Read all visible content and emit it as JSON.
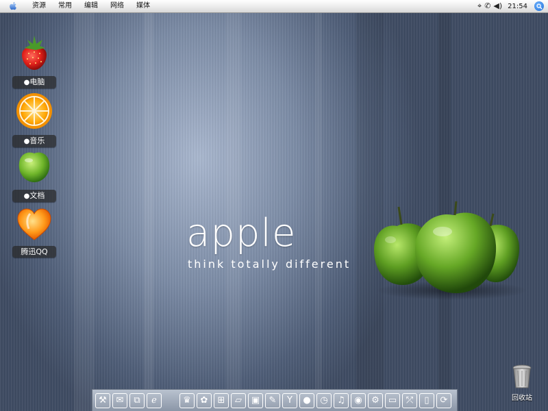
{
  "menubar": {
    "apple_menu_icon": "apple-logo",
    "items": [
      "资源",
      "常用",
      "编辑",
      "网络",
      "媒体"
    ],
    "tray": {
      "network_icon": "network-icon",
      "phone_icon": "phone-icon",
      "volume_icon": "volume-icon",
      "clock": "21:54",
      "search_icon": "search-icon"
    }
  },
  "desktop": {
    "icons": [
      {
        "label": "电脑",
        "icon": "strawberry-icon"
      },
      {
        "label": "音乐",
        "icon": "orange-icon"
      },
      {
        "label": "文档",
        "icon": "green-apple-icon"
      },
      {
        "label": "腾迅QQ",
        "icon": "heart-icon"
      }
    ],
    "brand_title": "apple",
    "brand_tagline": "think totally different",
    "trash_label": "回收站"
  },
  "dock": {
    "items": [
      {
        "icon": "tools-icon",
        "glyph": "⚒"
      },
      {
        "icon": "mail-icon",
        "glyph": "✉"
      },
      {
        "icon": "network-links-icon",
        "glyph": "⧉"
      },
      {
        "icon": "browser-icon",
        "glyph": "ℯ"
      },
      {
        "icon": "crown-icon",
        "glyph": "♛"
      },
      {
        "icon": "flower-icon",
        "glyph": "✿"
      },
      {
        "icon": "puzzle-icon",
        "glyph": "⊞"
      },
      {
        "icon": "note-icon",
        "glyph": "▱"
      },
      {
        "icon": "clipboard-icon",
        "glyph": "▣"
      },
      {
        "icon": "pen-icon",
        "glyph": "✎"
      },
      {
        "icon": "shirt-icon",
        "glyph": "Y"
      },
      {
        "icon": "fruit-icon",
        "glyph": "●"
      },
      {
        "icon": "clock-icon",
        "glyph": "◷"
      },
      {
        "icon": "music-icon",
        "glyph": "♫"
      },
      {
        "icon": "disc-icon",
        "glyph": "◉"
      },
      {
        "icon": "gears-icon",
        "glyph": "⚙"
      },
      {
        "icon": "monitor-icon",
        "glyph": "▭"
      },
      {
        "icon": "share-icon",
        "glyph": "⤱"
      },
      {
        "icon": "trash-dock-icon",
        "glyph": "▯"
      },
      {
        "icon": "refresh-icon",
        "glyph": "⟳"
      }
    ]
  },
  "colors": {
    "menubar_bg": "#e9e9e9",
    "desktop_bg": "#45536c",
    "apple_green": "#6fae2c",
    "label_bg": "#282828"
  }
}
